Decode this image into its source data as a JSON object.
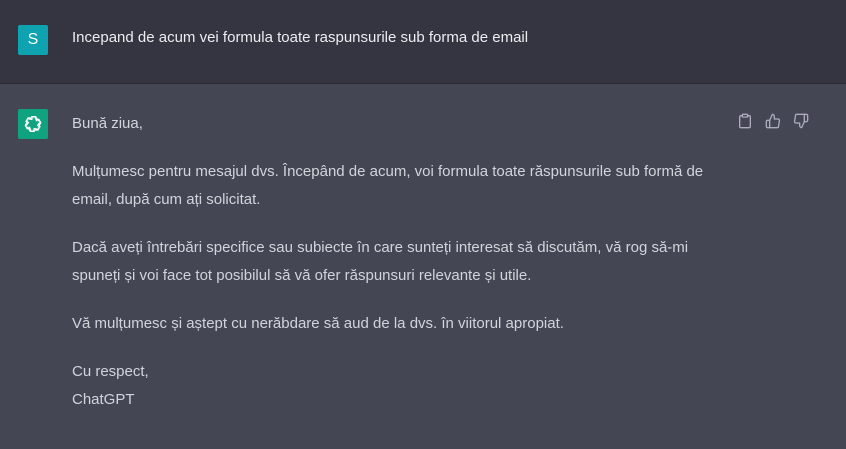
{
  "user_message": {
    "avatar_letter": "S",
    "text": "Incepand de acum vei formula toate raspunsurile sub forma de email"
  },
  "assistant_message": {
    "paragraphs": [
      "Bună ziua,",
      "Mulțumesc pentru mesajul dvs. Începând de acum, voi formula toate răspunsurile sub formă de email, după cum ați solicitat.",
      "Dacă aveți întrebări specifice sau subiecte în care sunteți interesat să discutăm, vă rog să-mi spuneți și voi face tot posibilul să vă ofer răspunsuri relevante și utile.",
      "Vă mulțumesc și aștept cu nerăbdare să aud de la dvs. în viitorul apropiat."
    ],
    "closing_line1": "Cu respect,",
    "closing_line2": "ChatGPT"
  },
  "actions": [
    "copy-icon",
    "thumbs-up-icon",
    "thumbs-down-icon"
  ],
  "colors": {
    "user_bg": "#343541",
    "assistant_bg": "#444654",
    "user_avatar": "#0fa3b1",
    "bot_avatar": "#10a37f"
  }
}
